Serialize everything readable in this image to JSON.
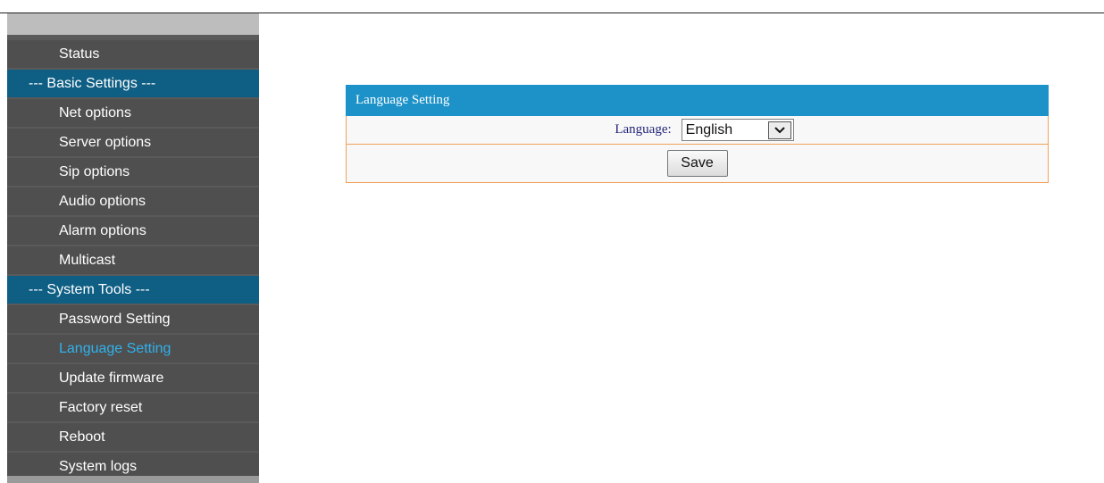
{
  "sidebar": {
    "items": [
      {
        "label": "Status",
        "type": "item"
      },
      {
        "label": "--- Basic Settings ---",
        "type": "section"
      },
      {
        "label": "Net options",
        "type": "item"
      },
      {
        "label": "Server options",
        "type": "item"
      },
      {
        "label": "Sip options",
        "type": "item"
      },
      {
        "label": "Audio options",
        "type": "item"
      },
      {
        "label": "Alarm options",
        "type": "item"
      },
      {
        "label": "Multicast",
        "type": "item"
      },
      {
        "label": "--- System Tools ---",
        "type": "section"
      },
      {
        "label": "Password Setting",
        "type": "item"
      },
      {
        "label": "Language Setting",
        "type": "item",
        "active": true
      },
      {
        "label": "Update firmware",
        "type": "item"
      },
      {
        "label": "Factory reset",
        "type": "item"
      },
      {
        "label": "Reboot",
        "type": "item"
      },
      {
        "label": "System logs",
        "type": "item"
      }
    ]
  },
  "panel": {
    "title": "Language Setting",
    "language_label": "Language:",
    "language_value": "English",
    "save_label": "Save"
  },
  "colors": {
    "section_bg": "#0f5e84",
    "active_text": "#2fb2ec",
    "panel_header": "#1d92c9",
    "panel_border": "#f0a15a"
  },
  "icons": {
    "select_arrow": "chevron-down-icon"
  }
}
